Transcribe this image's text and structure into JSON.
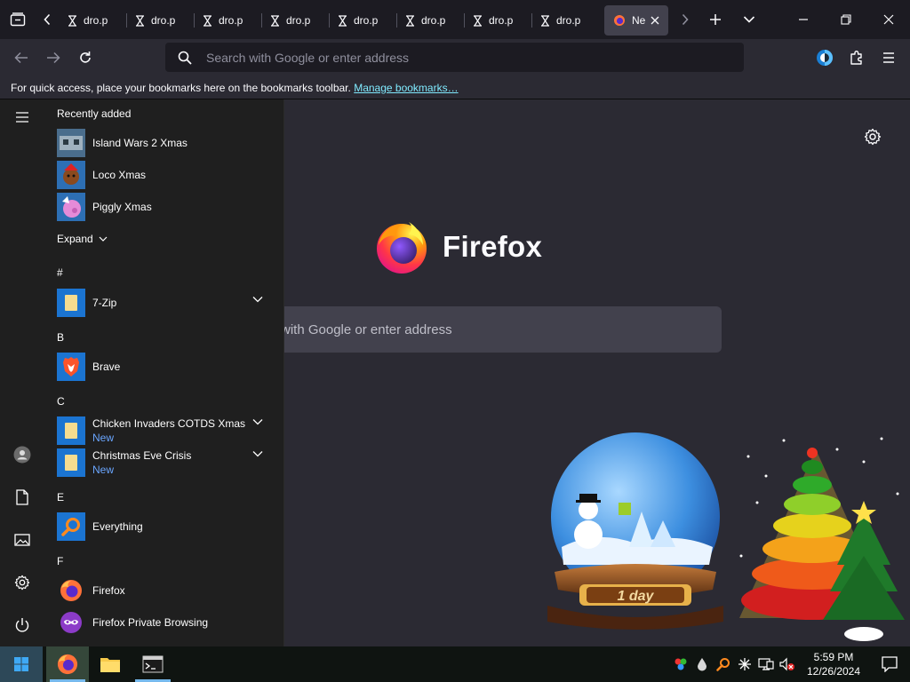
{
  "tabs": [
    {
      "title": "dro.p"
    },
    {
      "title": "dro.p"
    },
    {
      "title": "dro.p"
    },
    {
      "title": "dro.p"
    },
    {
      "title": "dro.p"
    },
    {
      "title": "dro.p"
    },
    {
      "title": "dro.p"
    },
    {
      "title": "dro.p"
    }
  ],
  "active_tab": {
    "title": "Ne"
  },
  "urlbar": {
    "placeholder": "Search with Google or enter address"
  },
  "bookmarks": {
    "text": "For quick access, place your bookmarks here on the bookmarks toolbar.",
    "link": "Manage bookmarks…"
  },
  "newtab": {
    "brand": "Firefox",
    "search_text": "with Google or enter address"
  },
  "startmenu": {
    "recently_added_label": "Recently added",
    "recent": [
      {
        "name": "Island Wars 2 Xmas"
      },
      {
        "name": "Loco Xmas"
      },
      {
        "name": "Piggly Xmas"
      }
    ],
    "expand_label": "Expand",
    "groups": [
      {
        "letter": "#"
      },
      {
        "letter": "B"
      },
      {
        "letter": "C"
      },
      {
        "letter": "E"
      },
      {
        "letter": "F"
      }
    ],
    "apps": {
      "zip": "7-Zip",
      "brave": "Brave",
      "chicken": "Chicken Invaders COTDS Xmas",
      "chicken_badge": "New",
      "christmas": "Christmas Eve Crisis",
      "christmas_badge": "New",
      "everything": "Everything",
      "firefox": "Firefox",
      "firefox_private": "Firefox Private Browsing"
    }
  },
  "gadgets": {
    "countdown": "1 day"
  },
  "taskbar": {
    "time": "5:59 PM",
    "date": "12/26/2024"
  },
  "colors": {
    "accent": "#80ebff",
    "new_badge": "#6aa6ff",
    "folder_tile": "#1b74d1"
  }
}
